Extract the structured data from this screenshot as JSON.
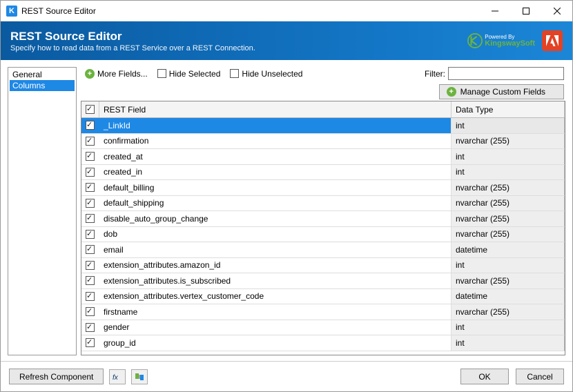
{
  "window": {
    "title": "REST Source Editor"
  },
  "banner": {
    "title": "REST Source Editor",
    "subtitle": "Specify how to read data from a REST Service over a REST Connection."
  },
  "sidebar": {
    "items": [
      {
        "label": "General",
        "selected": false
      },
      {
        "label": "Columns",
        "selected": true
      }
    ]
  },
  "toolbar": {
    "more_fields": "More Fields...",
    "hide_selected": "Hide Selected",
    "hide_unselected": "Hide Unselected",
    "filter_label": "Filter:",
    "filter_value": "",
    "manage_custom": "Manage Custom Fields"
  },
  "grid": {
    "header_field": "REST Field",
    "header_type": "Data Type",
    "rows": [
      {
        "checked": true,
        "selected": true,
        "field": "_LinkId",
        "type": "int"
      },
      {
        "checked": true,
        "selected": false,
        "field": "confirmation",
        "type": "nvarchar (255)"
      },
      {
        "checked": true,
        "selected": false,
        "field": "created_at",
        "type": "int"
      },
      {
        "checked": true,
        "selected": false,
        "field": "created_in",
        "type": "int"
      },
      {
        "checked": true,
        "selected": false,
        "field": "default_billing",
        "type": "nvarchar (255)"
      },
      {
        "checked": true,
        "selected": false,
        "field": "default_shipping",
        "type": "nvarchar (255)"
      },
      {
        "checked": true,
        "selected": false,
        "field": "disable_auto_group_change",
        "type": "nvarchar (255)"
      },
      {
        "checked": true,
        "selected": false,
        "field": "dob",
        "type": "nvarchar (255)"
      },
      {
        "checked": true,
        "selected": false,
        "field": "email",
        "type": "datetime"
      },
      {
        "checked": true,
        "selected": false,
        "field": "extension_attributes.amazon_id",
        "type": "int"
      },
      {
        "checked": true,
        "selected": false,
        "field": "extension_attributes.is_subscribed",
        "type": "nvarchar (255)"
      },
      {
        "checked": true,
        "selected": false,
        "field": "extension_attributes.vertex_customer_code",
        "type": "datetime"
      },
      {
        "checked": true,
        "selected": false,
        "field": "firstname",
        "type": "nvarchar (255)"
      },
      {
        "checked": true,
        "selected": false,
        "field": "gender",
        "type": "int"
      },
      {
        "checked": true,
        "selected": false,
        "field": "group_id",
        "type": "int"
      }
    ]
  },
  "footer": {
    "refresh": "Refresh Component",
    "ok": "OK",
    "cancel": "Cancel"
  },
  "logos": {
    "kingsway_pb": "Powered By",
    "kingsway": "KingswaySoft"
  }
}
